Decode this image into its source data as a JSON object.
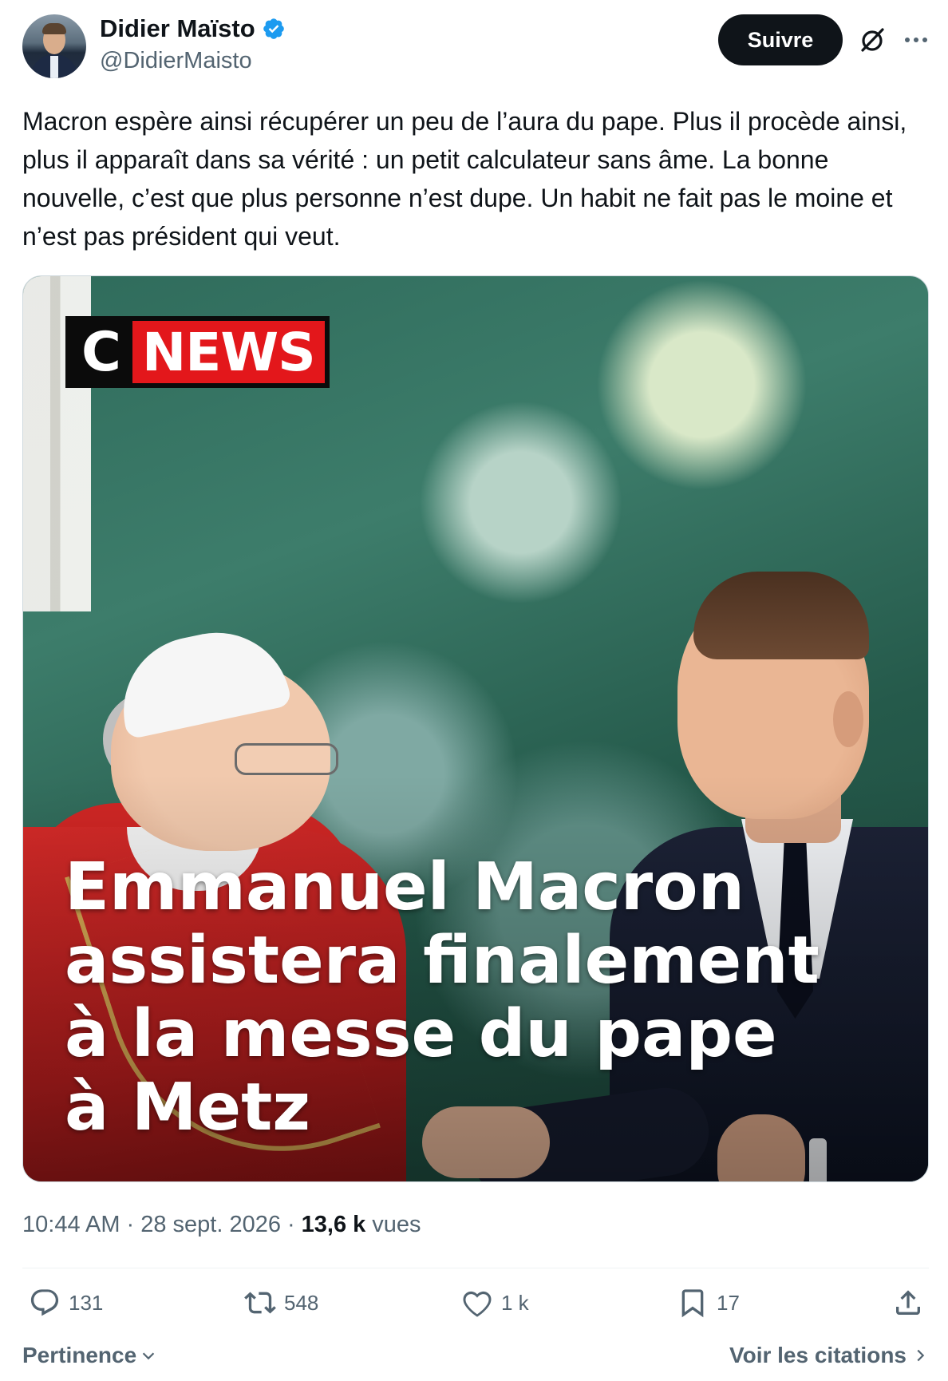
{
  "author": {
    "display_name": "Didier Maïsto",
    "handle": "@DidierMaisto",
    "verified": true
  },
  "header": {
    "follow_label": "Suivre"
  },
  "tweet": {
    "text": "Macron espère ainsi récupérer un peu de l’aura du pape. Plus il procède ainsi, plus il apparaît dans sa vérité : un petit calculateur sans âme. La bonne nouvelle, c’est que plus personne n’est dupe. Un habit ne fait pas le moine et n’est pas président qui veut."
  },
  "media": {
    "logo_c": "C",
    "logo_news": "NEWS",
    "headline": "Emmanuel Macron assistera finalement à la messe du pape à Metz"
  },
  "meta": {
    "time": "10:44 AM",
    "separator": "·",
    "date": "28 sept. 2026",
    "views_count": "13,6 k",
    "views_label": "vues"
  },
  "actions": {
    "replies": "131",
    "retweets": "548",
    "likes": "1 k",
    "bookmarks": "17"
  },
  "footer": {
    "sort_label": "Pertinence",
    "quotes_label": "Voir les citations"
  },
  "colors": {
    "accent": "#1d9bf0",
    "text_primary": "#0f1419",
    "text_secondary": "#536471",
    "cnews_red": "#e3171b"
  }
}
